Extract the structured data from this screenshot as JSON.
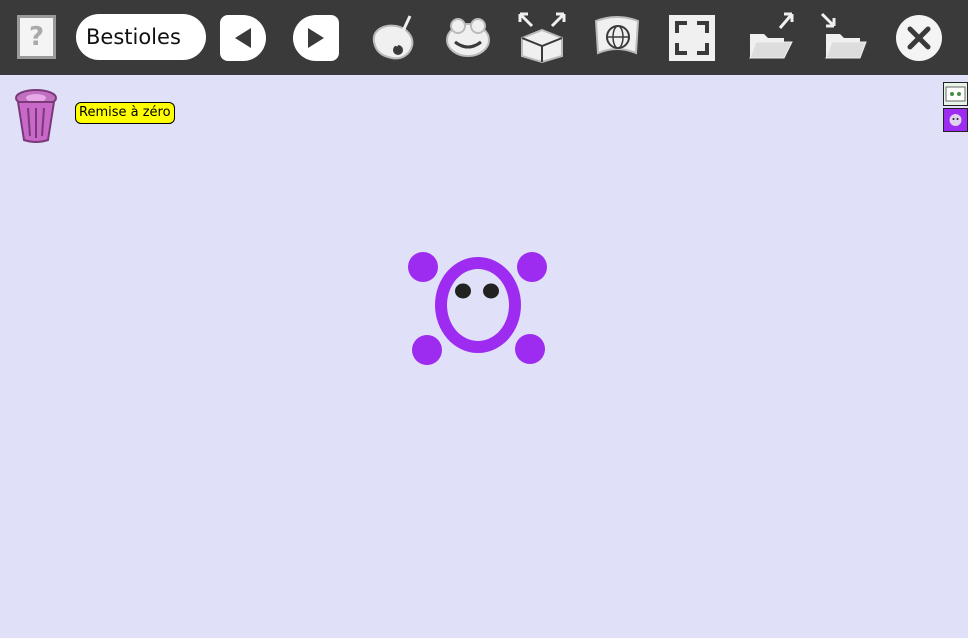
{
  "toolbar": {
    "help_label": "?",
    "activity_title": "Bestioles",
    "icons": [
      "help-icon",
      "previous-icon",
      "next-icon",
      "paint-palette-icon",
      "frog-face-icon",
      "box-expand-icon",
      "globe-flag-icon",
      "fullscreen-icon",
      "folder-open-export-icon",
      "folder-open-import-icon",
      "close-icon"
    ]
  },
  "workspace": {
    "reset_label": "Remise à zéro"
  },
  "colors": {
    "toolbar_bg": "#3a3a3a",
    "canvas_bg": "#e0e0f8",
    "creature": "#9d2cf0",
    "reset_bg": "#ffff00"
  }
}
